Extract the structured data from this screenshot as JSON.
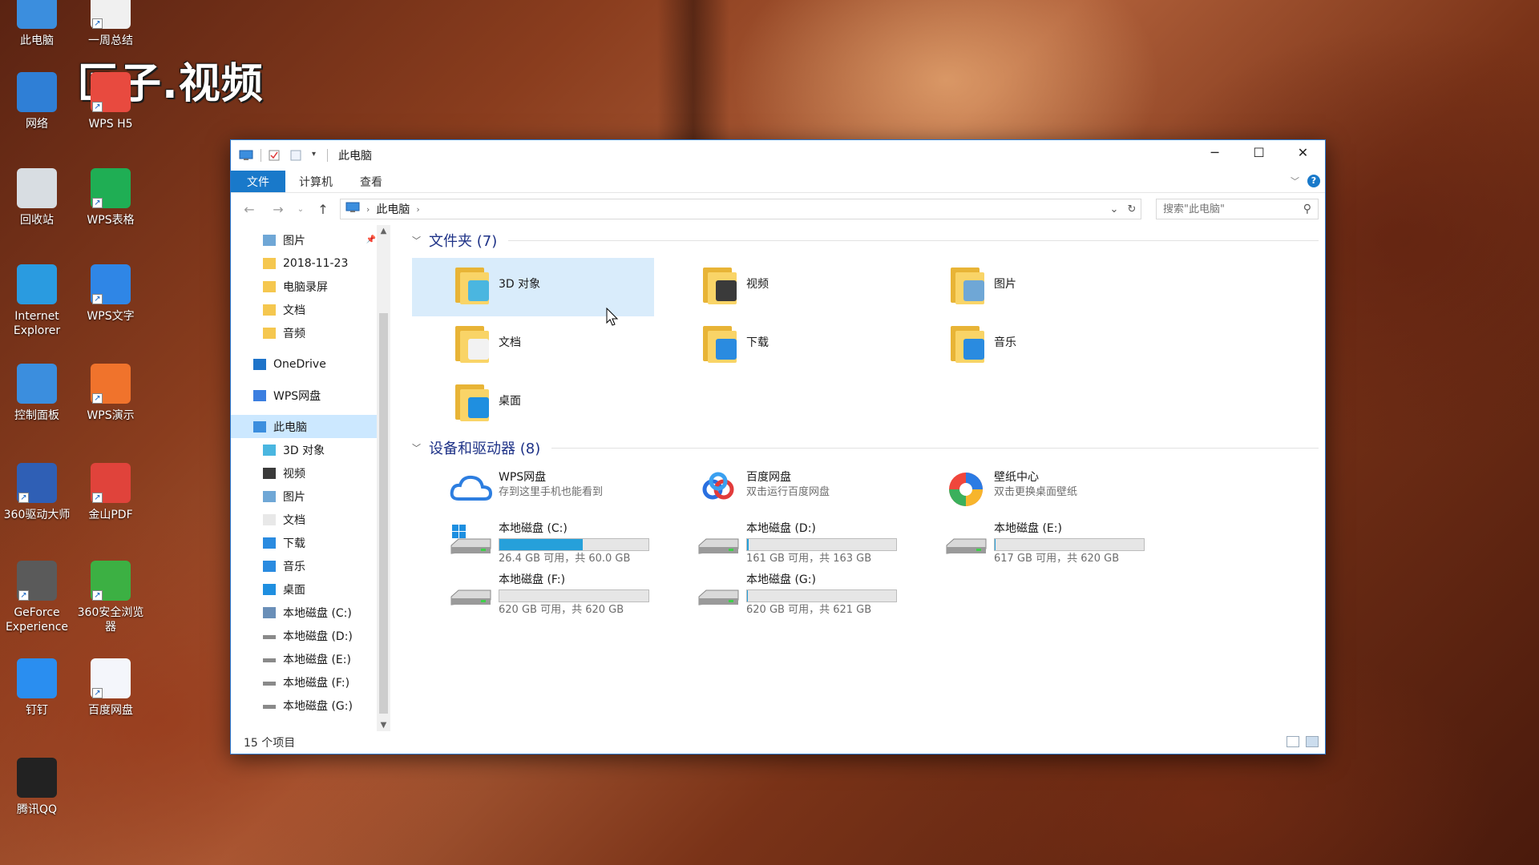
{
  "watermark": "叵子.视频",
  "desktop": {
    "icons": [
      {
        "label": "此电脑",
        "icon": "computer-icon",
        "color": "#3b8ede"
      },
      {
        "label": "一周总结",
        "icon": "document-icon",
        "color": "#f0f0f0"
      },
      {
        "label": "网络",
        "icon": "network-icon",
        "color": "#2f7fd6"
      },
      {
        "label": "WPS H5",
        "icon": "wps-h5-icon",
        "color": "#e84a3f"
      },
      {
        "label": "回收站",
        "icon": "recycle-bin-icon",
        "color": "#d8dde2"
      },
      {
        "label": "WPS表格",
        "icon": "wps-spreadsheet-icon",
        "color": "#1fae54"
      },
      {
        "label": "Internet Explorer",
        "icon": "internet-explorer-icon",
        "color": "#2a9be0"
      },
      {
        "label": "WPS文字",
        "icon": "wps-writer-icon",
        "color": "#2f86e6"
      },
      {
        "label": "控制面板",
        "icon": "control-panel-icon",
        "color": "#3b8ede"
      },
      {
        "label": "WPS演示",
        "icon": "wps-presentation-icon",
        "color": "#f0732c"
      },
      {
        "label": "360驱动大师",
        "icon": "driver-master-icon",
        "color": "#2f5fb5"
      },
      {
        "label": "金山PDF",
        "icon": "kingsoft-pdf-icon",
        "color": "#e0433b"
      },
      {
        "label": "GeForce Experience",
        "icon": "geforce-icon",
        "color": "#5a5a5a"
      },
      {
        "label": "360安全浏览器",
        "icon": "360-browser-icon",
        "color": "#3cb043"
      },
      {
        "label": "钉钉",
        "icon": "dingtalk-icon",
        "color": "#2a8ef0"
      },
      {
        "label": "百度网盘",
        "icon": "baidu-netdisk-icon",
        "color": "#f4f6fb"
      },
      {
        "label": "腾讯QQ",
        "icon": "qq-icon",
        "color": "#222222"
      }
    ]
  },
  "window": {
    "title": "此电脑",
    "controls": {
      "minimize": "─",
      "maximize": "☐",
      "close": "✕"
    },
    "ribbon_tabs": [
      "文件",
      "计算机",
      "查看"
    ],
    "address": {
      "crumb": "此电脑",
      "search_placeholder": "搜索\"此电脑\""
    },
    "nav_items": [
      {
        "label": "图片",
        "icon": "pictures-icon",
        "level": "l1",
        "pinned": true
      },
      {
        "label": "2018-11-23",
        "icon": "folder-icon",
        "level": "l1"
      },
      {
        "label": "电脑录屏",
        "icon": "folder-icon",
        "level": "l1"
      },
      {
        "label": "文档",
        "icon": "folder-icon",
        "level": "l1"
      },
      {
        "label": "音频",
        "icon": "folder-icon",
        "level": "l1"
      },
      {
        "label": "OneDrive",
        "icon": "onedrive-icon",
        "level": "l0",
        "gap": true
      },
      {
        "label": "WPS网盘",
        "icon": "wps-cloud-icon",
        "level": "l0",
        "gap": true
      },
      {
        "label": "此电脑",
        "icon": "computer-icon",
        "level": "l0",
        "gap": true,
        "selected": true
      },
      {
        "label": "3D 对象",
        "icon": "3d-objects-icon",
        "level": "l1"
      },
      {
        "label": "视频",
        "icon": "videos-icon",
        "level": "l1"
      },
      {
        "label": "图片",
        "icon": "pictures-icon",
        "level": "l1"
      },
      {
        "label": "文档",
        "icon": "documents-icon",
        "level": "l1"
      },
      {
        "label": "下载",
        "icon": "downloads-icon",
        "level": "l1"
      },
      {
        "label": "音乐",
        "icon": "music-icon",
        "level": "l1"
      },
      {
        "label": "桌面",
        "icon": "desktop-icon",
        "level": "l1"
      },
      {
        "label": "本地磁盘 (C:)",
        "icon": "drive-c-icon",
        "level": "l1"
      },
      {
        "label": "本地磁盘 (D:)",
        "icon": "drive-icon",
        "level": "l1"
      },
      {
        "label": "本地磁盘 (E:)",
        "icon": "drive-icon",
        "level": "l1"
      },
      {
        "label": "本地磁盘 (F:)",
        "icon": "drive-icon",
        "level": "l1"
      },
      {
        "label": "本地磁盘 (G:)",
        "icon": "drive-icon",
        "level": "l1"
      }
    ],
    "folders_header": "文件夹 (7)",
    "folders": [
      {
        "label": "3D 对象",
        "icon": "3d-objects-icon",
        "badge": "#4ab6e0",
        "highlight": true
      },
      {
        "label": "视频",
        "icon": "videos-icon",
        "badge": "#3a3a3a"
      },
      {
        "label": "图片",
        "icon": "pictures-icon",
        "badge": "#6fa7d6"
      },
      {
        "label": "文档",
        "icon": "documents-icon",
        "badge": "#f2f2f2"
      },
      {
        "label": "下载",
        "icon": "downloads-icon",
        "badge": "#2a8be0"
      },
      {
        "label": "音乐",
        "icon": "music-icon",
        "badge": "#2a8be0"
      },
      {
        "label": "桌面",
        "icon": "desktop-icon",
        "badge": "#1f8fe0"
      }
    ],
    "drives_header": "设备和驱动器 (8)",
    "drives": [
      {
        "name": "WPS网盘",
        "sub": "存到这里手机也能看到",
        "icon": "wps-cloud-icon",
        "kind": "cloud"
      },
      {
        "name": "百度网盘",
        "sub": "双击运行百度网盘",
        "icon": "baidu-netdisk-icon",
        "kind": "cloud"
      },
      {
        "name": "壁纸中心",
        "sub": "双击更换桌面壁纸",
        "icon": "wallpaper-center-icon",
        "kind": "cloud"
      },
      {
        "name": "本地磁盘 (C:)",
        "sub": "26.4 GB 可用，共 60.0 GB",
        "icon": "drive-c-icon",
        "kind": "disk",
        "used_fraction": 0.56
      },
      {
        "name": "本地磁盘 (D:)",
        "sub": "161 GB 可用，共 163 GB",
        "icon": "drive-icon",
        "kind": "disk",
        "used_fraction": 0.012
      },
      {
        "name": "本地磁盘 (E:)",
        "sub": "617 GB 可用，共 620 GB",
        "icon": "drive-icon",
        "kind": "disk",
        "used_fraction": 0.005
      },
      {
        "name": "本地磁盘 (F:)",
        "sub": "620 GB 可用，共 620 GB",
        "icon": "drive-icon",
        "kind": "disk",
        "used_fraction": 0.0
      },
      {
        "name": "本地磁盘 (G:)",
        "sub": "620 GB 可用，共 621 GB",
        "icon": "drive-icon",
        "kind": "disk",
        "used_fraction": 0.002
      }
    ],
    "status": "15 个项目"
  }
}
